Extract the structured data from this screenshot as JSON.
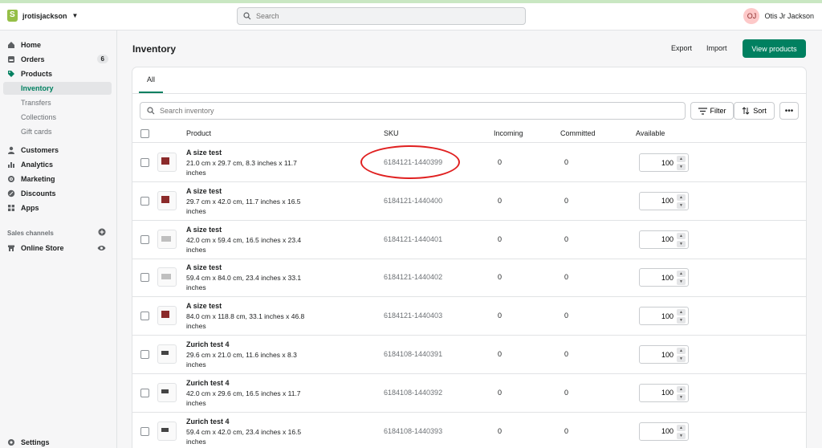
{
  "topbar": {
    "store_name": "jrotisjackson",
    "search_placeholder": "Search",
    "user_initials": "OJ",
    "user_name": "Otis Jr Jackson"
  },
  "sidebar": {
    "items": [
      {
        "label": "Home",
        "icon": "home-icon"
      },
      {
        "label": "Orders",
        "icon": "orders-icon",
        "badge": "6"
      },
      {
        "label": "Products",
        "icon": "tag-icon"
      },
      {
        "label": "Inventory"
      },
      {
        "label": "Transfers"
      },
      {
        "label": "Collections"
      },
      {
        "label": "Gift cards"
      },
      {
        "label": "Customers",
        "icon": "person-icon"
      },
      {
        "label": "Analytics",
        "icon": "chart-icon"
      },
      {
        "label": "Marketing",
        "icon": "target-icon"
      },
      {
        "label": "Discounts",
        "icon": "discount-icon"
      },
      {
        "label": "Apps",
        "icon": "apps-icon"
      }
    ],
    "sales_channels_title": "Sales channels",
    "online_store": "Online Store",
    "settings": "Settings"
  },
  "page": {
    "title": "Inventory",
    "export_label": "Export",
    "import_label": "Import",
    "view_products_label": "View products",
    "tab_all": "All",
    "search_placeholder": "Search inventory",
    "filter_label": "Filter",
    "sort_label": "Sort"
  },
  "table": {
    "headers": {
      "product": "Product",
      "sku": "SKU",
      "incoming": "Incoming",
      "committed": "Committed",
      "available": "Available"
    },
    "rows": [
      {
        "name": "A size test",
        "variant": "21.0 cm x 29.7 cm, 8.3 inches x 11.7 inches",
        "sku": "6184121-1440399",
        "incoming": "0",
        "committed": "0",
        "available": "100"
      },
      {
        "name": "A size test",
        "variant": "29.7 cm x 42.0 cm, 11.7 inches x 16.5 inches",
        "sku": "6184121-1440400",
        "incoming": "0",
        "committed": "0",
        "available": "100"
      },
      {
        "name": "A size test",
        "variant": "42.0 cm x 59.4 cm, 16.5 inches x 23.4 inches",
        "sku": "6184121-1440401",
        "incoming": "0",
        "committed": "0",
        "available": "100"
      },
      {
        "name": "A size test",
        "variant": "59.4 cm x 84.0 cm, 23.4 inches x 33.1 inches",
        "sku": "6184121-1440402",
        "incoming": "0",
        "committed": "0",
        "available": "100"
      },
      {
        "name": "A size test",
        "variant": "84.0 cm x 118.8 cm, 33.1 inches x 46.8 inches",
        "sku": "6184121-1440403",
        "incoming": "0",
        "committed": "0",
        "available": "100"
      },
      {
        "name": "Zurich test 4",
        "variant": "29.6 cm x 21.0 cm, 11.6 inches x 8.3 inches",
        "sku": "6184108-1440391",
        "incoming": "0",
        "committed": "0",
        "available": "100"
      },
      {
        "name": "Zurich test 4",
        "variant": "42.0 cm x 29.6 cm, 16.5 inches x 11.7 inches",
        "sku": "6184108-1440392",
        "incoming": "0",
        "committed": "0",
        "available": "100"
      },
      {
        "name": "Zurich test 4",
        "variant": "59.4 cm x 42.0 cm, 23.4 inches x 16.5 inches",
        "sku": "6184108-1440393",
        "incoming": "0",
        "committed": "0",
        "available": "100"
      }
    ]
  },
  "colors": {
    "accent": "#008060",
    "annotation": "#e02020"
  }
}
